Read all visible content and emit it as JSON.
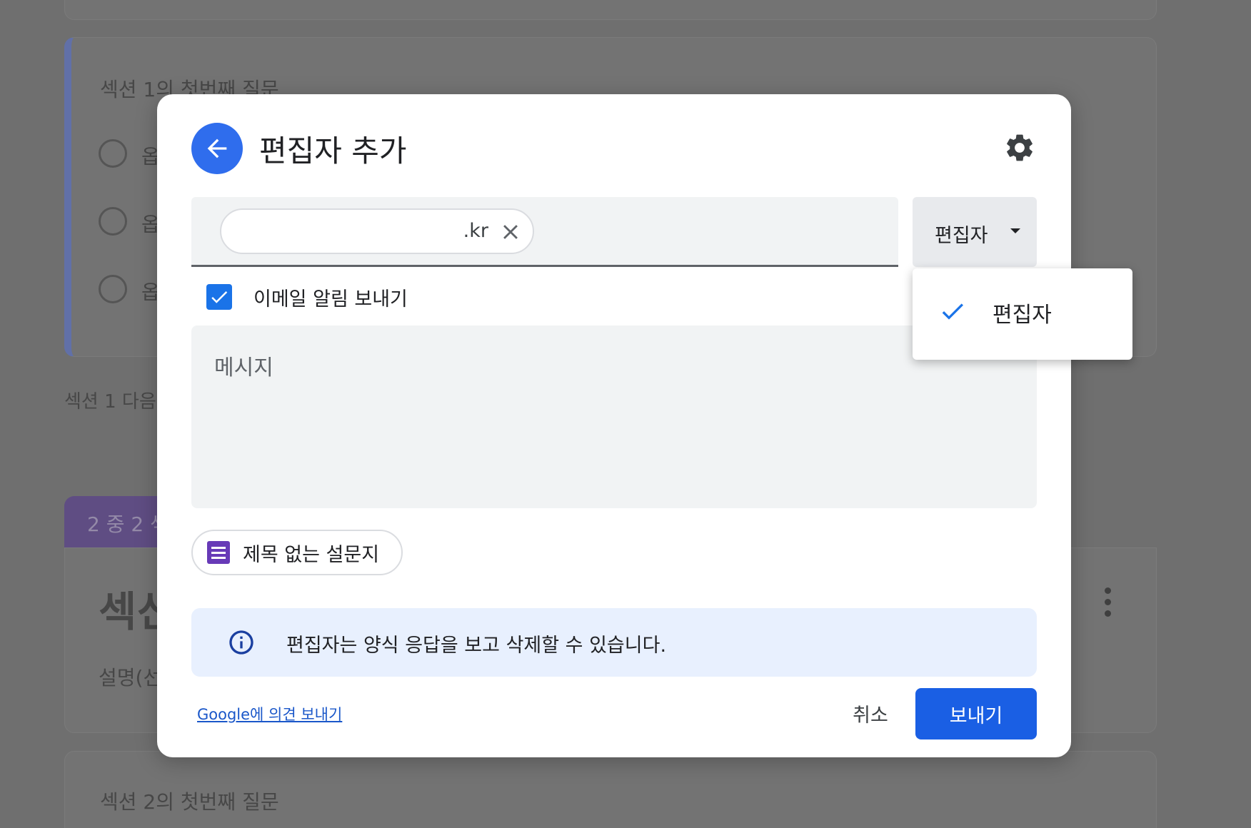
{
  "background": {
    "question1": "섹션 1의 첫번째 질문",
    "options": [
      "옵",
      "옵",
      "옵"
    ],
    "after_section": "섹션 1 다음",
    "section_tag": "2 중 2 섹",
    "section_title": "섹신",
    "description": "설명(선",
    "question2": "섹션 2의 첫번째 질문"
  },
  "dialog": {
    "title": "편집자 추가",
    "recipient_chip": ".kr",
    "role_button": "편집자",
    "notify_label": "이메일 알림 보내기",
    "notify_checked": true,
    "message_placeholder": "메시지",
    "form_chip": "제목 없는 설문지",
    "info_text": "편집자는 양식 응답을 보고 삭제할 수 있습니다.",
    "feedback_link": "Google에 의견 보내기",
    "cancel": "취소",
    "send": "보내기"
  },
  "role_menu": {
    "items": [
      {
        "label": "편집자",
        "selected": true
      }
    ]
  },
  "colors": {
    "accent_blue": "#1a73e8",
    "send_button": "#1a5fe4",
    "info_bg": "#e8f0fe",
    "forms_purple": "#673ab7"
  },
  "icons": [
    "arrow-back-icon",
    "gear-icon",
    "close-icon",
    "dropdown-caret-icon",
    "checkbox-check-icon",
    "forms-icon",
    "info-icon",
    "checkmark-icon"
  ]
}
